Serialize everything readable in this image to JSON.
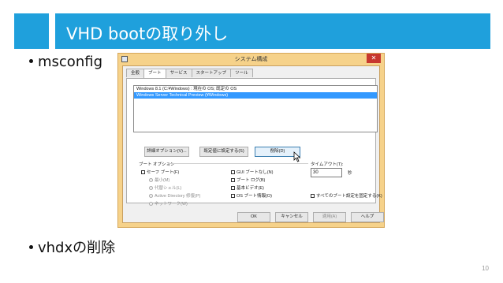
{
  "slide": {
    "title": "VHD bootの取り外し",
    "bullets": [
      "msconfig",
      "vhdxの削除"
    ],
    "page_number": "10",
    "accent_color": "#1fa0dc"
  },
  "dialog": {
    "title": "システム構成",
    "close_glyph": "✕",
    "tabs": [
      "全般",
      "ブート",
      "サービス",
      "スタートアップ",
      "ツール"
    ],
    "active_tab": "ブート",
    "os_entries": [
      {
        "text": "Windows 8.1 (C:¥Windows) : 現在の OS; 既定の OS",
        "selected": false
      },
      {
        "text": "Windows Server Technical Preview (¥Windows)",
        "selected": true
      }
    ],
    "buttons": {
      "advanced": "詳細オプション(V)...",
      "set_default": "既定値に設定する(S)",
      "delete": "削除(D)",
      "ok": "OK",
      "cancel": "キャンセル",
      "apply": "適用(A)",
      "help": "ヘルプ"
    },
    "boot_options": {
      "group_label": "ブート オプション",
      "safe_boot": "セーフ ブート(F)",
      "minimal": "最小(M)",
      "alt_shell": "代替シェル(L)",
      "ad_repair": "Active Directory 修復(P)",
      "network": "ネットワーク(W)",
      "no_gui": "GUI ブートなし(N)",
      "boot_log": "ブート ログ(B)",
      "base_video": "基本ビデオ(E)",
      "os_info": "OS ブート情報(O)",
      "make_permanent": "すべてのブート設定を固定する(K)"
    },
    "timeout": {
      "label": "タイムアウト(T):",
      "value": "30",
      "unit": "秒"
    }
  }
}
